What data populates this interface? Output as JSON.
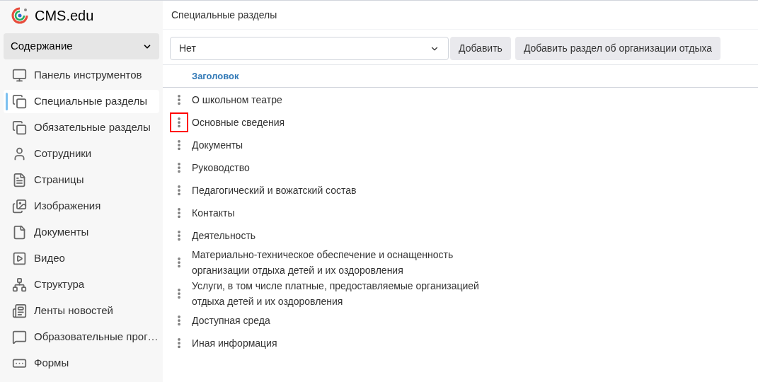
{
  "app": {
    "name": "CMS.edu"
  },
  "sidebar": {
    "section_dropdown": "Содержание",
    "items": [
      {
        "label": "Панель инструментов",
        "selected": false
      },
      {
        "label": "Специальные разделы",
        "selected": true
      },
      {
        "label": "Обязательные разделы",
        "selected": false
      },
      {
        "label": "Сотрудники",
        "selected": false
      },
      {
        "label": "Страницы",
        "selected": false
      },
      {
        "label": "Изображения",
        "selected": false
      },
      {
        "label": "Документы",
        "selected": false
      },
      {
        "label": "Видео",
        "selected": false
      },
      {
        "label": "Структура",
        "selected": false
      },
      {
        "label": "Ленты новостей",
        "selected": false
      },
      {
        "label": "Образовательные прог…",
        "selected": false
      },
      {
        "label": "Формы",
        "selected": false
      }
    ]
  },
  "main": {
    "title": "Специальные разделы",
    "select_value": "Нет",
    "buttons": [
      "Добавить",
      "Добавить раздел об организации отдыха"
    ],
    "table": {
      "column": "Заголовок",
      "rows": [
        {
          "title": "О школьном театре",
          "highlighted": false
        },
        {
          "title": "Основные сведения",
          "highlighted": true
        },
        {
          "title": "Документы",
          "highlighted": false
        },
        {
          "title": "Руководство",
          "highlighted": false
        },
        {
          "title": "Педагогический и вожатский состав",
          "highlighted": false
        },
        {
          "title": "Контакты",
          "highlighted": false
        },
        {
          "title": "Деятельность",
          "highlighted": false
        },
        {
          "title": "Материально-техническое обеспечение и оснащенность организации отдыха детей и их оздоровления",
          "highlighted": false
        },
        {
          "title": "Услуги, в том числе платные, предоставляемые организацией отдыха детей и их оздоровления",
          "highlighted": false
        },
        {
          "title": "Доступная среда",
          "highlighted": false
        },
        {
          "title": "Иная информация",
          "highlighted": false
        }
      ]
    }
  }
}
